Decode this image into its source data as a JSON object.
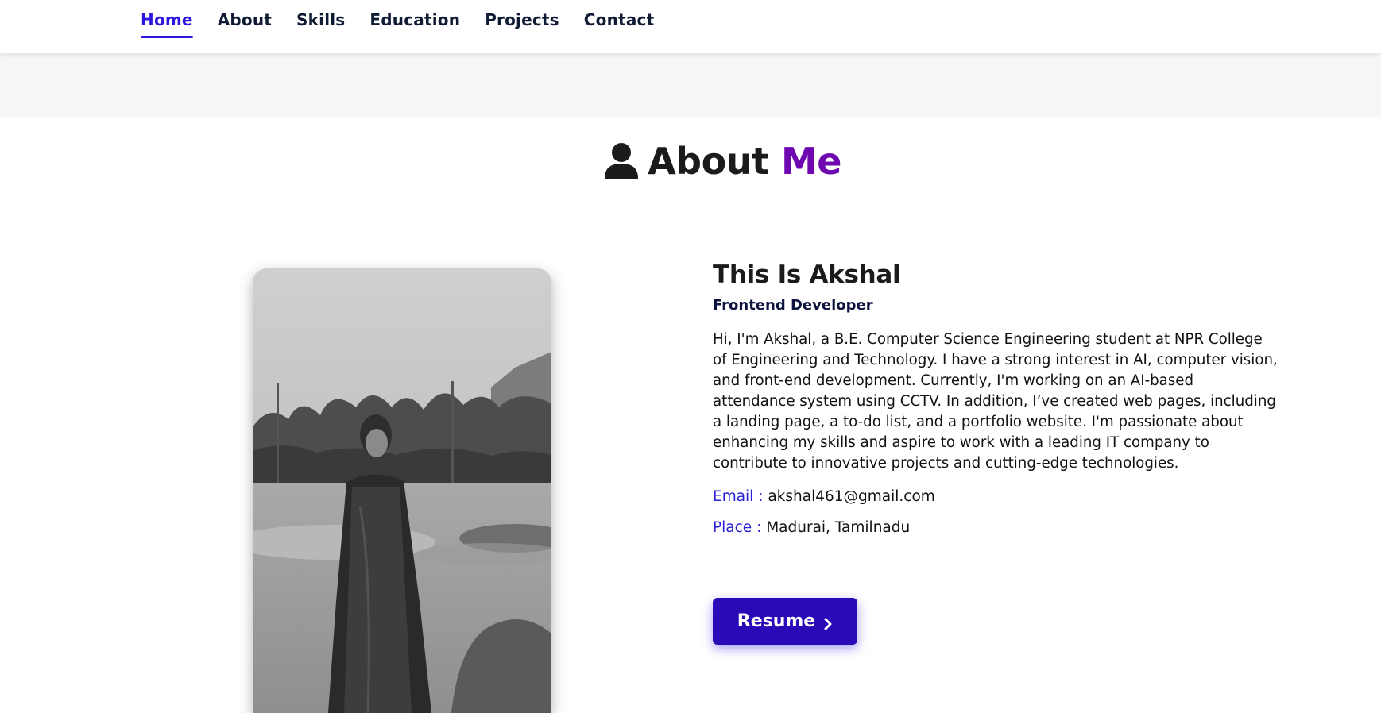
{
  "nav": {
    "items": [
      {
        "label": "Home",
        "active": true
      },
      {
        "label": "About",
        "active": false
      },
      {
        "label": "Skills",
        "active": false
      },
      {
        "label": "Education",
        "active": false
      },
      {
        "label": "Projects",
        "active": false
      },
      {
        "label": "Contact",
        "active": false
      }
    ]
  },
  "section": {
    "icon": "user-icon",
    "title_main": "About",
    "title_accent": "Me"
  },
  "profile": {
    "photo_icon": "profile-photo",
    "name_heading": "This Is Akshal",
    "role": "Frontend Developer",
    "bio": "Hi, I'm Akshal, a B.E. Computer Science Engineering student at NPR College of Engineering and Technology. I have a strong interest in AI, computer vision, and front-end development. Currently, I'm working on an AI-based attendance system using CCTV. In addition, I’ve created web pages, including a landing page, a to-do list, and a portfolio website. I'm passionate about enhancing my skills and aspire to work with a leading IT company to contribute to innovative projects and cutting-edge technologies.",
    "email_label": "Email :",
    "email_value": "akshal461@gmail.com",
    "place_label": "Place :",
    "place_value": "Madurai, Tamilnadu"
  },
  "resume_button": {
    "label": "Resume",
    "icon": "chevron-right-icon"
  },
  "colors": {
    "nav_active": "#2b16e0",
    "accent_purple": "#6e07b0",
    "label_blue": "#2a22d6",
    "button_bg": "#2a09b7"
  }
}
